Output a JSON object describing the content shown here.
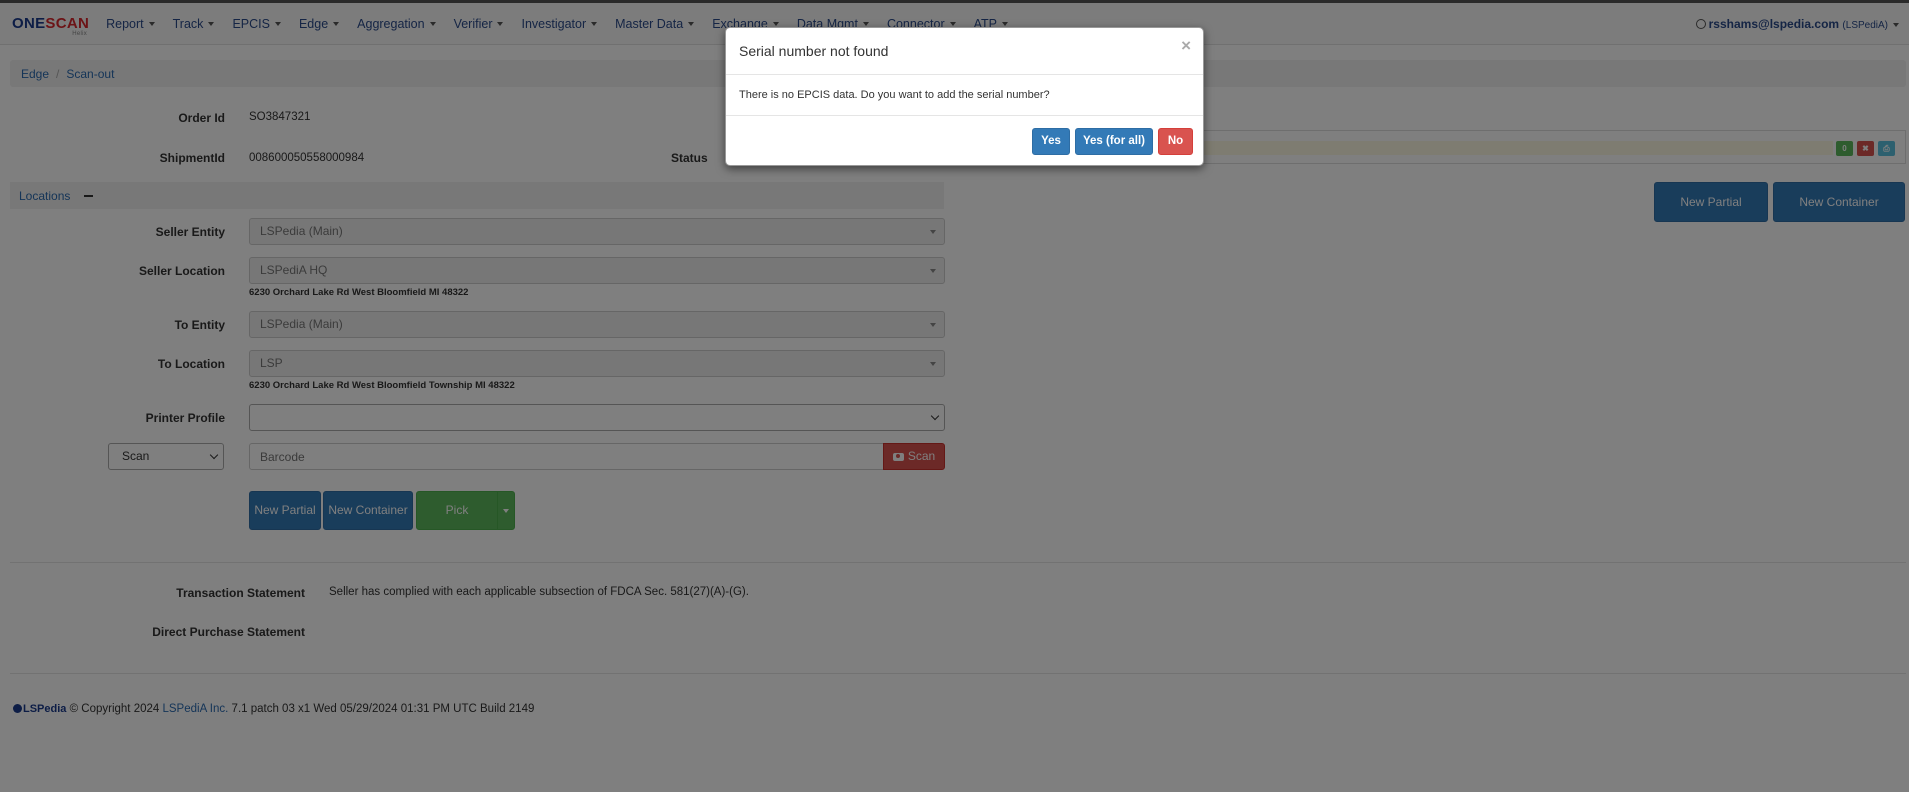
{
  "app": {
    "logo_one": "ONE",
    "logo_scan": "SCAN",
    "logo_sub": "Helix"
  },
  "nav": {
    "items": [
      "Report",
      "Track",
      "EPCIS",
      "Edge",
      "Aggregation",
      "Verifier",
      "Investigator",
      "Master Data",
      "Exchange",
      "Data Mgmt",
      "Connector",
      "ATP"
    ],
    "user_email": "rsshams@lspedia.com",
    "user_org": "(LSPediA)"
  },
  "breadcrumb": {
    "items": [
      "Edge",
      "Scan-out"
    ]
  },
  "order": {
    "order_id_label": "Order Id",
    "order_id": "SO3847321",
    "shipment_label": "ShipmentId",
    "shipment_id": "008600050558000984",
    "status_label": "Status"
  },
  "locations": {
    "title": "Locations",
    "seller_entity_label": "Seller Entity",
    "seller_entity": "LSPedia (Main)",
    "seller_location_label": "Seller Location",
    "seller_location": "LSPediA HQ",
    "seller_address": "6230 Orchard Lake Rd West Bloomfield MI 48322",
    "to_entity_label": "To Entity",
    "to_entity": "LSPedia (Main)",
    "to_location_label": "To Location",
    "to_location": "LSP",
    "to_address": "6230 Orchard Lake Rd West Bloomfield Township MI 48322",
    "printer_label": "Printer Profile",
    "printer_value": ""
  },
  "scan": {
    "mode": "Scan",
    "barcode_placeholder": "Barcode",
    "scan_button": "Scan"
  },
  "actions": {
    "new_partial": "New Partial",
    "new_container": "New Container",
    "pick": "Pick"
  },
  "statements": {
    "transaction_label": "Transaction Statement",
    "transaction_text": "Seller has complied with each applicable subsection of FDCA Sec. 581(27)(A)-(G).",
    "direct_label": "Direct Purchase Statement"
  },
  "right_panel": {
    "count_badge": "0",
    "new_partial": "New Partial",
    "new_container": "New Container"
  },
  "footer": {
    "brand": "LSPedia",
    "copyright": "© Copyright 2024",
    "company": "LSPediA Inc.",
    "build": "7.1 patch 03 x1 Wed 05/29/2024 01:31 PM UTC Build 2149"
  },
  "modal": {
    "title": "Serial number not found",
    "body": "There is no EPCIS data. Do you want to add the serial number?",
    "close": "×",
    "yes": "Yes",
    "yes_all": "Yes (for all)",
    "no": "No"
  },
  "colors": {
    "primary": "#337ab7",
    "danger": "#d9534f",
    "success": "#5cb85c",
    "brand_blue": "#1a3b8c"
  }
}
